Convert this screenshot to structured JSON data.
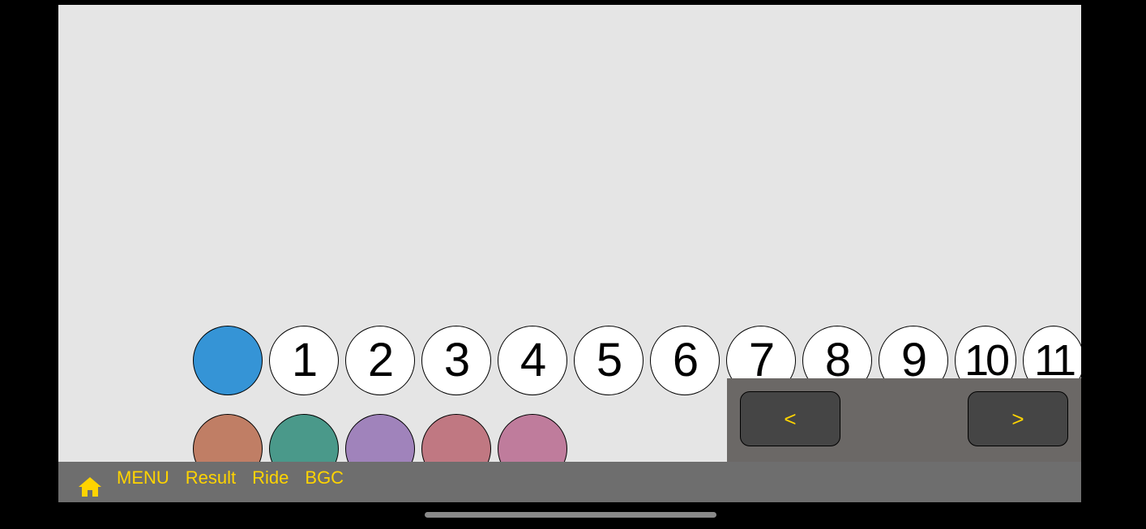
{
  "circles": {
    "selected_color": "#3594d6",
    "numbers": [
      "1",
      "2",
      "3",
      "4",
      "5",
      "6",
      "7",
      "8",
      "9",
      "10",
      "11"
    ]
  },
  "colors": {
    "swatches": [
      "#c07e65",
      "#4a998a",
      "#a083bb",
      "#c07882",
      "#bf7c9c"
    ]
  },
  "nav": {
    "prev_label": "<",
    "next_label": ">"
  },
  "toolbar": {
    "home_icon": "home-icon",
    "items": [
      "MENU",
      "Result",
      "Ride",
      "BGC"
    ]
  },
  "theme": {
    "accent": "#ffd400",
    "canvas": "#e5e5e5",
    "toolbar_bg": "#6e6e6e",
    "nav_panel_bg": "#6b6866"
  }
}
